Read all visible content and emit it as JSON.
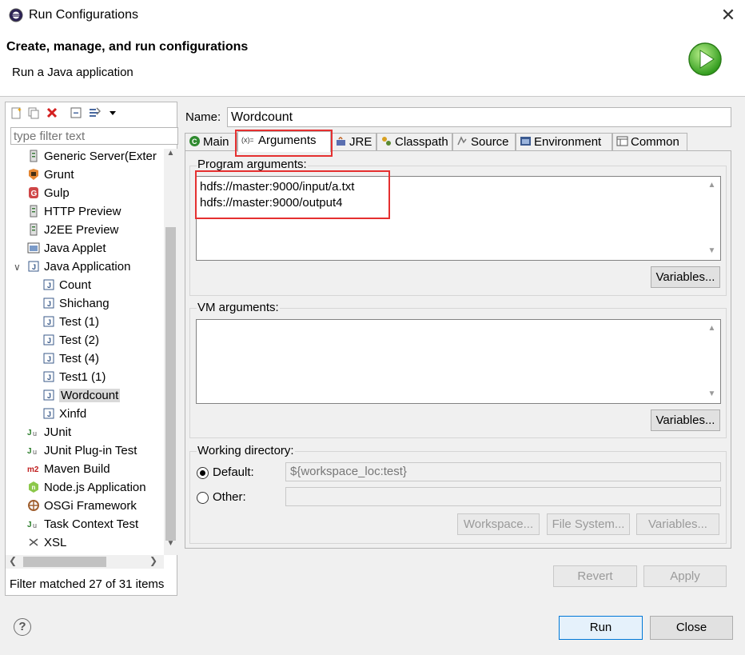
{
  "window": {
    "title": "Run Configurations",
    "close_glyph": "✕"
  },
  "header": {
    "title": "Create, manage, and run configurations",
    "subtitle": "Run a Java application",
    "banner_icon": "run-play-icon"
  },
  "left": {
    "toolbar_icons": [
      "new-config-icon",
      "duplicate-icon",
      "delete-icon",
      "collapse-all-icon",
      "filter-icon",
      "dropdown-arrow-icon"
    ],
    "filter_placeholder": "type filter text",
    "tree": [
      {
        "label": "Generic Server(Exter",
        "icon": "server-icon",
        "level": 0
      },
      {
        "label": "Grunt",
        "icon": "grunt-icon",
        "level": 0
      },
      {
        "label": "Gulp",
        "icon": "gulp-icon",
        "level": 0
      },
      {
        "label": "HTTP Preview",
        "icon": "server-icon",
        "level": 0
      },
      {
        "label": "J2EE Preview",
        "icon": "server-icon",
        "level": 0
      },
      {
        "label": "Java Applet",
        "icon": "applet-icon",
        "level": 0
      },
      {
        "label": "Java Application",
        "icon": "java-app-icon",
        "level": 0,
        "expanded": true
      },
      {
        "label": "Count",
        "icon": "java-app-icon",
        "level": 1
      },
      {
        "label": "Shichang",
        "icon": "java-app-icon",
        "level": 1
      },
      {
        "label": "Test (1)",
        "icon": "java-app-icon",
        "level": 1
      },
      {
        "label": "Test (2)",
        "icon": "java-app-icon",
        "level": 1
      },
      {
        "label": "Test (4)",
        "icon": "java-app-icon",
        "level": 1
      },
      {
        "label": "Test1 (1)",
        "icon": "java-app-icon",
        "level": 1
      },
      {
        "label": "Wordcount",
        "icon": "java-app-icon",
        "level": 1,
        "selected": true
      },
      {
        "label": "Xinfd",
        "icon": "java-app-icon",
        "level": 1
      },
      {
        "label": "JUnit",
        "icon": "junit-icon",
        "level": 0
      },
      {
        "label": "JUnit Plug-in Test",
        "icon": "junit-icon",
        "level": 0
      },
      {
        "label": "Maven Build",
        "icon": "maven-icon",
        "level": 0
      },
      {
        "label": "Node.js Application",
        "icon": "nodejs-icon",
        "level": 0
      },
      {
        "label": "OSGi Framework",
        "icon": "osgi-icon",
        "level": 0
      },
      {
        "label": "Task Context Test",
        "icon": "junit-icon",
        "level": 0
      },
      {
        "label": "XSL",
        "icon": "xsl-icon",
        "level": 0
      }
    ],
    "filter_status": "Filter matched 27 of 31 items"
  },
  "config": {
    "name_label": "Name:",
    "name_value": "Wordcount",
    "tabs": [
      {
        "label": "Main",
        "icon": "main-tab-icon"
      },
      {
        "label": "Arguments",
        "icon": "arguments-icon",
        "active": true
      },
      {
        "label": "JRE",
        "icon": "jre-icon"
      },
      {
        "label": "Classpath",
        "icon": "classpath-icon"
      },
      {
        "label": "Source",
        "icon": "source-icon"
      },
      {
        "label": "Environment",
        "icon": "environment-icon"
      },
      {
        "label": "Common",
        "icon": "common-icon"
      }
    ],
    "program_args_label": "Program arguments:",
    "program_args_value": "hdfs://master:9000/input/a.txt\nhdfs://master:9000/output4",
    "variables_label": "Variables...",
    "vm_args_label": "VM arguments:",
    "vm_args_value": "",
    "working_dir_label": "Working directory:",
    "default_label": "Default:",
    "default_value": "${workspace_loc:test}",
    "other_label": "Other:",
    "other_value": "",
    "workspace_btn": "Workspace...",
    "filesystem_btn": "File System...",
    "variables_btn_disabled": "Variables...",
    "revert_label": "Revert",
    "apply_label": "Apply"
  },
  "footer": {
    "help_glyph": "?",
    "run_label": "Run",
    "close_label": "Close"
  },
  "colors": {
    "highlight_red": "#e53030",
    "selected_bg": "#d9d9d9",
    "default_button_border": "#0078d7"
  }
}
